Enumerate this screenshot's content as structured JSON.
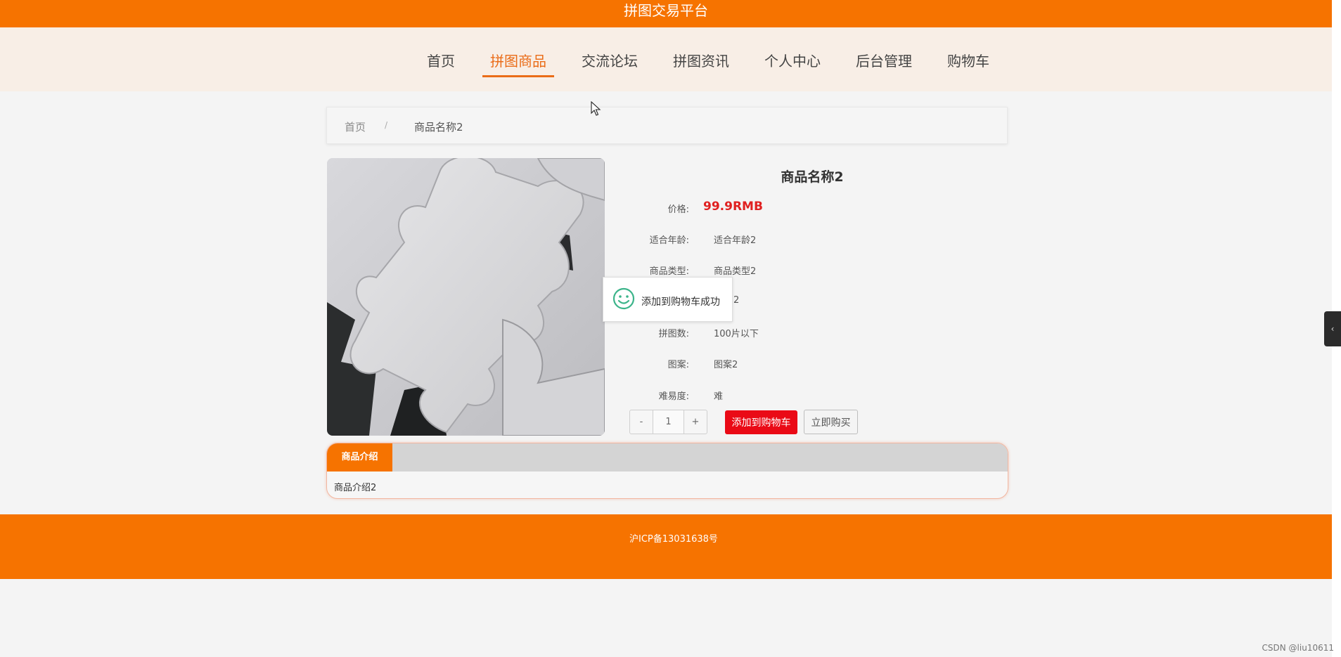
{
  "header": {
    "title": "拼图交易平台"
  },
  "nav": {
    "items": [
      {
        "label": "首页"
      },
      {
        "label": "拼图商品"
      },
      {
        "label": "交流论坛"
      },
      {
        "label": "拼图资讯"
      },
      {
        "label": "个人中心"
      },
      {
        "label": "后台管理"
      },
      {
        "label": "购物车"
      }
    ],
    "active_index": 1
  },
  "breadcrumb": {
    "home": "首页",
    "separator": "/",
    "current": "商品名称2"
  },
  "product": {
    "title": "商品名称2",
    "fields": [
      {
        "label": "价格:",
        "value": "99.9RMB"
      },
      {
        "label": "适合年龄:",
        "value": "适合年龄2"
      },
      {
        "label": "商品类型:",
        "value": "商品类型2"
      },
      {
        "label": "",
        "value": "2"
      },
      {
        "label": "拼图数:",
        "value": "100片以下"
      },
      {
        "label": "图案:",
        "value": "图案2"
      },
      {
        "label": "难易度:",
        "value": "难"
      }
    ]
  },
  "quantity": {
    "minus": "-",
    "value": "1",
    "plus": "+"
  },
  "actions": {
    "add_to_cart": "添加到购物车",
    "buy_now": "立即购买"
  },
  "toast": {
    "message": "添加到购物车成功",
    "icon": "smile-icon"
  },
  "tabs": {
    "active_label": "商品介绍",
    "content": "商品介绍2"
  },
  "footer": {
    "icp": "沪ICP备13031638号"
  },
  "watermark": "CSDN @liu10611",
  "colors": {
    "brand": "#f67300",
    "price": "#e02020",
    "cart_button": "#ea0a16"
  }
}
